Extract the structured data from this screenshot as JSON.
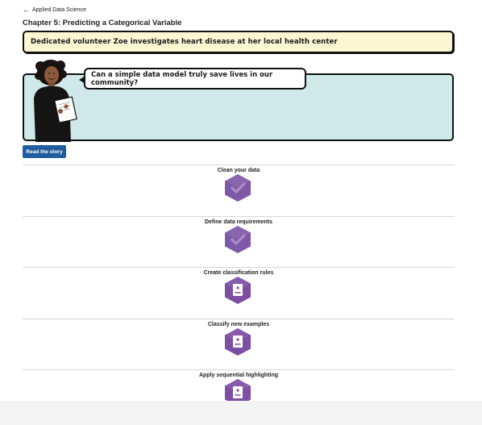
{
  "nav": {
    "back_label": "Applied Data Science",
    "back_icon": "arrow-left-icon"
  },
  "chapter": {
    "title": "Chapter 5: Predicting a Categorical Variable"
  },
  "banner": {
    "text": "Dedicated volunteer Zoe investigates heart disease at her local health center"
  },
  "story": {
    "speech": "Can a simple data model truly save lives in our community?",
    "read_button_label": "Read the story"
  },
  "lessons": [
    {
      "title": "Clean your data",
      "status": "completed",
      "icon": "checkmark-icon"
    },
    {
      "title": "Define data requirements",
      "status": "completed",
      "icon": "checkmark-icon"
    },
    {
      "title": "Create classification rules",
      "status": "available",
      "icon": "lesson-card-icon"
    },
    {
      "title": "Classify new examples",
      "status": "available",
      "icon": "lesson-card-icon"
    },
    {
      "title": "Apply sequential highlighting",
      "status": "available",
      "icon": "lesson-card-icon"
    }
  ],
  "colors": {
    "hex_completed": "#7d5aa8",
    "hex_available": "#7c4fa3",
    "button_blue": "#1f5d9e",
    "panel_teal": "#cfe8e9",
    "banner_yellow": "#fdf6d3"
  }
}
